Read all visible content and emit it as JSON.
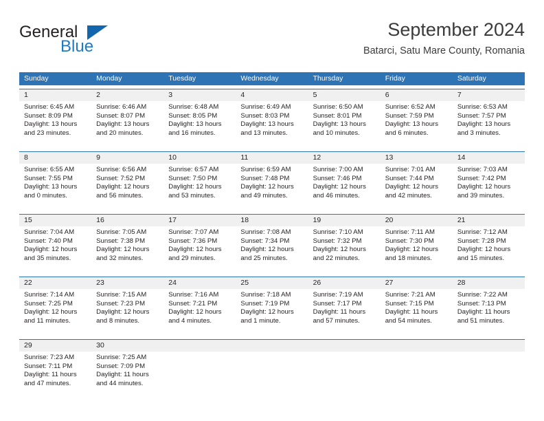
{
  "brand": {
    "name_part1": "General",
    "name_part2": "Blue",
    "triangle_color": "#1266ae",
    "blue_color": "#1f7ac4"
  },
  "header": {
    "month_title": "September 2024",
    "location": "Batarci, Satu Mare County, Romania"
  },
  "calendar": {
    "header_color": "#2e74b5",
    "daynum_background": "#f0f0f0",
    "weekdays": [
      "Sunday",
      "Monday",
      "Tuesday",
      "Wednesday",
      "Thursday",
      "Friday",
      "Saturday"
    ],
    "weeks": [
      [
        {
          "day": "1",
          "sunrise": "Sunrise: 6:45 AM",
          "sunset": "Sunset: 8:09 PM",
          "daylight1": "Daylight: 13 hours",
          "daylight2": "and 23 minutes."
        },
        {
          "day": "2",
          "sunrise": "Sunrise: 6:46 AM",
          "sunset": "Sunset: 8:07 PM",
          "daylight1": "Daylight: 13 hours",
          "daylight2": "and 20 minutes."
        },
        {
          "day": "3",
          "sunrise": "Sunrise: 6:48 AM",
          "sunset": "Sunset: 8:05 PM",
          "daylight1": "Daylight: 13 hours",
          "daylight2": "and 16 minutes."
        },
        {
          "day": "4",
          "sunrise": "Sunrise: 6:49 AM",
          "sunset": "Sunset: 8:03 PM",
          "daylight1": "Daylight: 13 hours",
          "daylight2": "and 13 minutes."
        },
        {
          "day": "5",
          "sunrise": "Sunrise: 6:50 AM",
          "sunset": "Sunset: 8:01 PM",
          "daylight1": "Daylight: 13 hours",
          "daylight2": "and 10 minutes."
        },
        {
          "day": "6",
          "sunrise": "Sunrise: 6:52 AM",
          "sunset": "Sunset: 7:59 PM",
          "daylight1": "Daylight: 13 hours",
          "daylight2": "and 6 minutes."
        },
        {
          "day": "7",
          "sunrise": "Sunrise: 6:53 AM",
          "sunset": "Sunset: 7:57 PM",
          "daylight1": "Daylight: 13 hours",
          "daylight2": "and 3 minutes."
        }
      ],
      [
        {
          "day": "8",
          "sunrise": "Sunrise: 6:55 AM",
          "sunset": "Sunset: 7:55 PM",
          "daylight1": "Daylight: 13 hours",
          "daylight2": "and 0 minutes."
        },
        {
          "day": "9",
          "sunrise": "Sunrise: 6:56 AM",
          "sunset": "Sunset: 7:52 PM",
          "daylight1": "Daylight: 12 hours",
          "daylight2": "and 56 minutes."
        },
        {
          "day": "10",
          "sunrise": "Sunrise: 6:57 AM",
          "sunset": "Sunset: 7:50 PM",
          "daylight1": "Daylight: 12 hours",
          "daylight2": "and 53 minutes."
        },
        {
          "day": "11",
          "sunrise": "Sunrise: 6:59 AM",
          "sunset": "Sunset: 7:48 PM",
          "daylight1": "Daylight: 12 hours",
          "daylight2": "and 49 minutes."
        },
        {
          "day": "12",
          "sunrise": "Sunrise: 7:00 AM",
          "sunset": "Sunset: 7:46 PM",
          "daylight1": "Daylight: 12 hours",
          "daylight2": "and 46 minutes."
        },
        {
          "day": "13",
          "sunrise": "Sunrise: 7:01 AM",
          "sunset": "Sunset: 7:44 PM",
          "daylight1": "Daylight: 12 hours",
          "daylight2": "and 42 minutes."
        },
        {
          "day": "14",
          "sunrise": "Sunrise: 7:03 AM",
          "sunset": "Sunset: 7:42 PM",
          "daylight1": "Daylight: 12 hours",
          "daylight2": "and 39 minutes."
        }
      ],
      [
        {
          "day": "15",
          "sunrise": "Sunrise: 7:04 AM",
          "sunset": "Sunset: 7:40 PM",
          "daylight1": "Daylight: 12 hours",
          "daylight2": "and 35 minutes."
        },
        {
          "day": "16",
          "sunrise": "Sunrise: 7:05 AM",
          "sunset": "Sunset: 7:38 PM",
          "daylight1": "Daylight: 12 hours",
          "daylight2": "and 32 minutes."
        },
        {
          "day": "17",
          "sunrise": "Sunrise: 7:07 AM",
          "sunset": "Sunset: 7:36 PM",
          "daylight1": "Daylight: 12 hours",
          "daylight2": "and 29 minutes."
        },
        {
          "day": "18",
          "sunrise": "Sunrise: 7:08 AM",
          "sunset": "Sunset: 7:34 PM",
          "daylight1": "Daylight: 12 hours",
          "daylight2": "and 25 minutes."
        },
        {
          "day": "19",
          "sunrise": "Sunrise: 7:10 AM",
          "sunset": "Sunset: 7:32 PM",
          "daylight1": "Daylight: 12 hours",
          "daylight2": "and 22 minutes."
        },
        {
          "day": "20",
          "sunrise": "Sunrise: 7:11 AM",
          "sunset": "Sunset: 7:30 PM",
          "daylight1": "Daylight: 12 hours",
          "daylight2": "and 18 minutes."
        },
        {
          "day": "21",
          "sunrise": "Sunrise: 7:12 AM",
          "sunset": "Sunset: 7:28 PM",
          "daylight1": "Daylight: 12 hours",
          "daylight2": "and 15 minutes."
        }
      ],
      [
        {
          "day": "22",
          "sunrise": "Sunrise: 7:14 AM",
          "sunset": "Sunset: 7:25 PM",
          "daylight1": "Daylight: 12 hours",
          "daylight2": "and 11 minutes."
        },
        {
          "day": "23",
          "sunrise": "Sunrise: 7:15 AM",
          "sunset": "Sunset: 7:23 PM",
          "daylight1": "Daylight: 12 hours",
          "daylight2": "and 8 minutes."
        },
        {
          "day": "24",
          "sunrise": "Sunrise: 7:16 AM",
          "sunset": "Sunset: 7:21 PM",
          "daylight1": "Daylight: 12 hours",
          "daylight2": "and 4 minutes."
        },
        {
          "day": "25",
          "sunrise": "Sunrise: 7:18 AM",
          "sunset": "Sunset: 7:19 PM",
          "daylight1": "Daylight: 12 hours",
          "daylight2": "and 1 minute."
        },
        {
          "day": "26",
          "sunrise": "Sunrise: 7:19 AM",
          "sunset": "Sunset: 7:17 PM",
          "daylight1": "Daylight: 11 hours",
          "daylight2": "and 57 minutes."
        },
        {
          "day": "27",
          "sunrise": "Sunrise: 7:21 AM",
          "sunset": "Sunset: 7:15 PM",
          "daylight1": "Daylight: 11 hours",
          "daylight2": "and 54 minutes."
        },
        {
          "day": "28",
          "sunrise": "Sunrise: 7:22 AM",
          "sunset": "Sunset: 7:13 PM",
          "daylight1": "Daylight: 11 hours",
          "daylight2": "and 51 minutes."
        }
      ],
      [
        {
          "day": "29",
          "sunrise": "Sunrise: 7:23 AM",
          "sunset": "Sunset: 7:11 PM",
          "daylight1": "Daylight: 11 hours",
          "daylight2": "and 47 minutes."
        },
        {
          "day": "30",
          "sunrise": "Sunrise: 7:25 AM",
          "sunset": "Sunset: 7:09 PM",
          "daylight1": "Daylight: 11 hours",
          "daylight2": "and 44 minutes."
        },
        {
          "day": "",
          "sunrise": "",
          "sunset": "",
          "daylight1": "",
          "daylight2": ""
        },
        {
          "day": "",
          "sunrise": "",
          "sunset": "",
          "daylight1": "",
          "daylight2": ""
        },
        {
          "day": "",
          "sunrise": "",
          "sunset": "",
          "daylight1": "",
          "daylight2": ""
        },
        {
          "day": "",
          "sunrise": "",
          "sunset": "",
          "daylight1": "",
          "daylight2": ""
        },
        {
          "day": "",
          "sunrise": "",
          "sunset": "",
          "daylight1": "",
          "daylight2": ""
        }
      ]
    ]
  }
}
